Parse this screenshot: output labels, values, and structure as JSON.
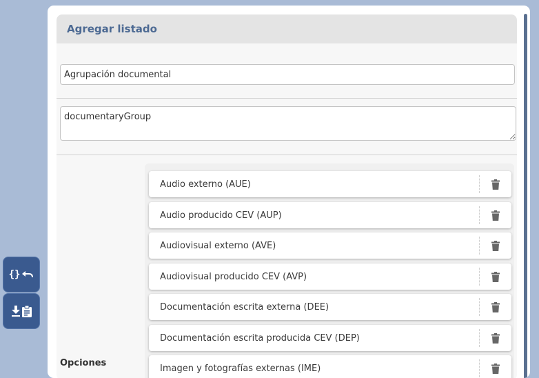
{
  "panel": {
    "title": "Agregar listado",
    "name_value": "Agrupación documental",
    "key_value": "documentaryGroup",
    "options_label": "Opciones"
  },
  "options": [
    {
      "label": "Audio externo (AUE)"
    },
    {
      "label": "Audio producido CEV (AUP)"
    },
    {
      "label": "Audiovisual externo (AVE)"
    },
    {
      "label": "Audiovisual producido CEV (AVP)"
    },
    {
      "label": "Documentación escrita externa (DEE)"
    },
    {
      "label": "Documentación escrita producida CEV (DEP)"
    },
    {
      "label": "Imagen y fotografías externas (IME)"
    }
  ],
  "toolbar": {
    "top_icons": [
      "braces-icon",
      "undo-icon"
    ],
    "bottom_icons": [
      "download-icon",
      "clipboard-icon"
    ]
  },
  "colors": {
    "page_bg": "#a9bbd6",
    "accent": "#4d6a93",
    "fab_bg": "#3a5a8f"
  }
}
